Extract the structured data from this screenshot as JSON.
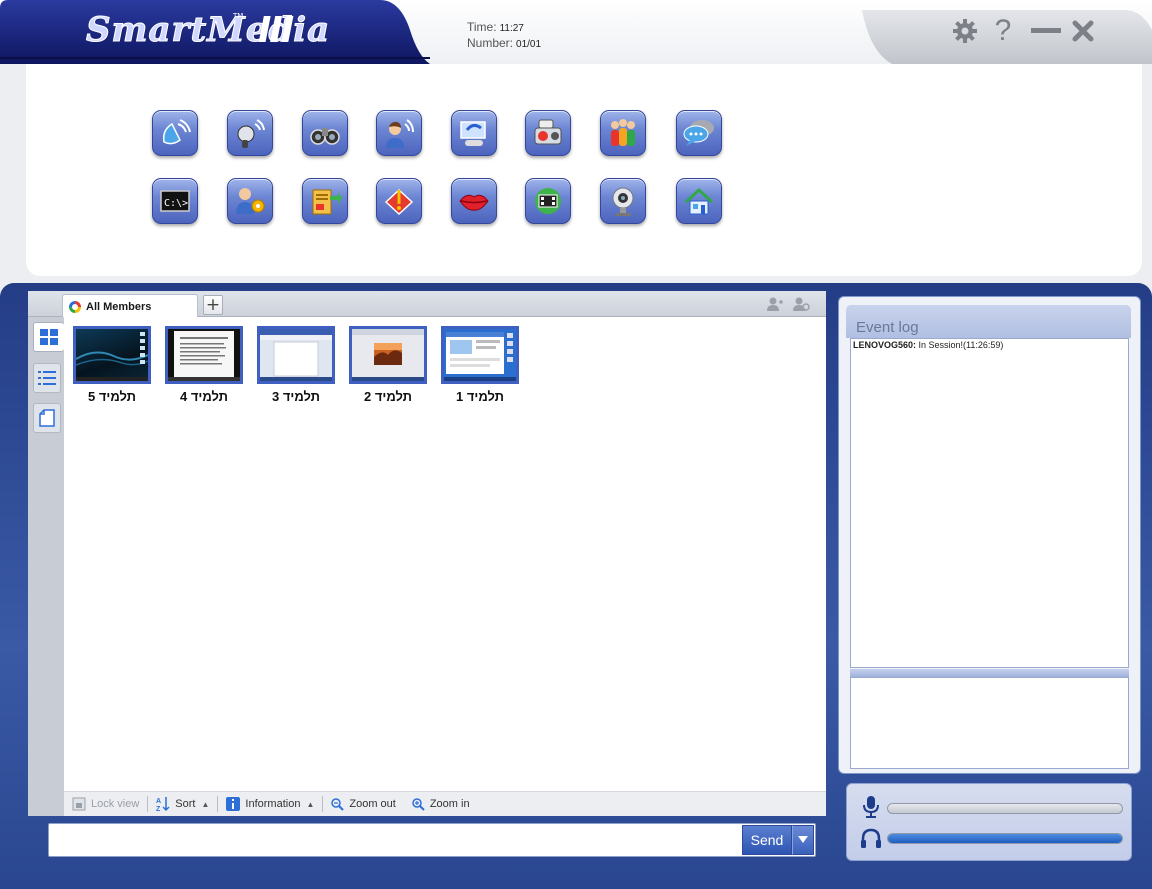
{
  "app": {
    "logo_text": "SmartMedia",
    "logo_version": "III",
    "logo_tm": "TM"
  },
  "status": {
    "time_label": "Time:",
    "time_value": "11:27",
    "number_label": "Number:",
    "number_value": "01/01"
  },
  "window_controls": {
    "settings_icon": "gear-icon",
    "help_label": "?",
    "minimize_icon": "minimize-icon",
    "close_icon": "close-icon"
  },
  "toolbar_row1": [
    {
      "icon": "broadcast-icon"
    },
    {
      "icon": "microphone-icon"
    },
    {
      "icon": "monitor-binoculars-icon"
    },
    {
      "icon": "speaking-student-icon"
    },
    {
      "icon": "screen-control-icon"
    },
    {
      "icon": "media-player-icon"
    },
    {
      "icon": "group-icon"
    },
    {
      "icon": "chat-icon"
    }
  ],
  "toolbar_row2": [
    {
      "icon": "command-prompt-icon"
    },
    {
      "icon": "student-settings-icon"
    },
    {
      "icon": "file-transfer-icon"
    },
    {
      "icon": "alert-icon"
    },
    {
      "icon": "lips-icon"
    },
    {
      "icon": "video-icon"
    },
    {
      "icon": "webcam-icon"
    },
    {
      "icon": "home-icon"
    }
  ],
  "tabs": {
    "all_members": "All Members",
    "add": "+"
  },
  "students": [
    {
      "label": "תלמיד 5",
      "screen": "dark-desktop"
    },
    {
      "label": "תלמיד 4",
      "screen": "document-dark"
    },
    {
      "label": "תלמיד 3",
      "screen": "word-document"
    },
    {
      "label": "תלמיד 2",
      "screen": "image-viewer"
    },
    {
      "label": "תלמיד 1",
      "screen": "web-browser"
    }
  ],
  "bottom_bar": {
    "lock_view": "Lock view",
    "sort": "Sort",
    "information": "Information",
    "zoom_out": "Zoom out",
    "zoom_in": "Zoom in"
  },
  "send": {
    "button": "Send",
    "placeholder": ""
  },
  "event_log": {
    "title": "Event log",
    "entries": [
      {
        "source": "LENOVOG560:",
        "message": " In Session!(11:26:59)"
      }
    ]
  },
  "audio": {
    "mic_level": 0.0,
    "speaker_level": 1.0
  },
  "colors": {
    "frame_blue": "#2c4a96",
    "button_blue": "#3f5fc1",
    "logo_dark": "#1a2270"
  }
}
